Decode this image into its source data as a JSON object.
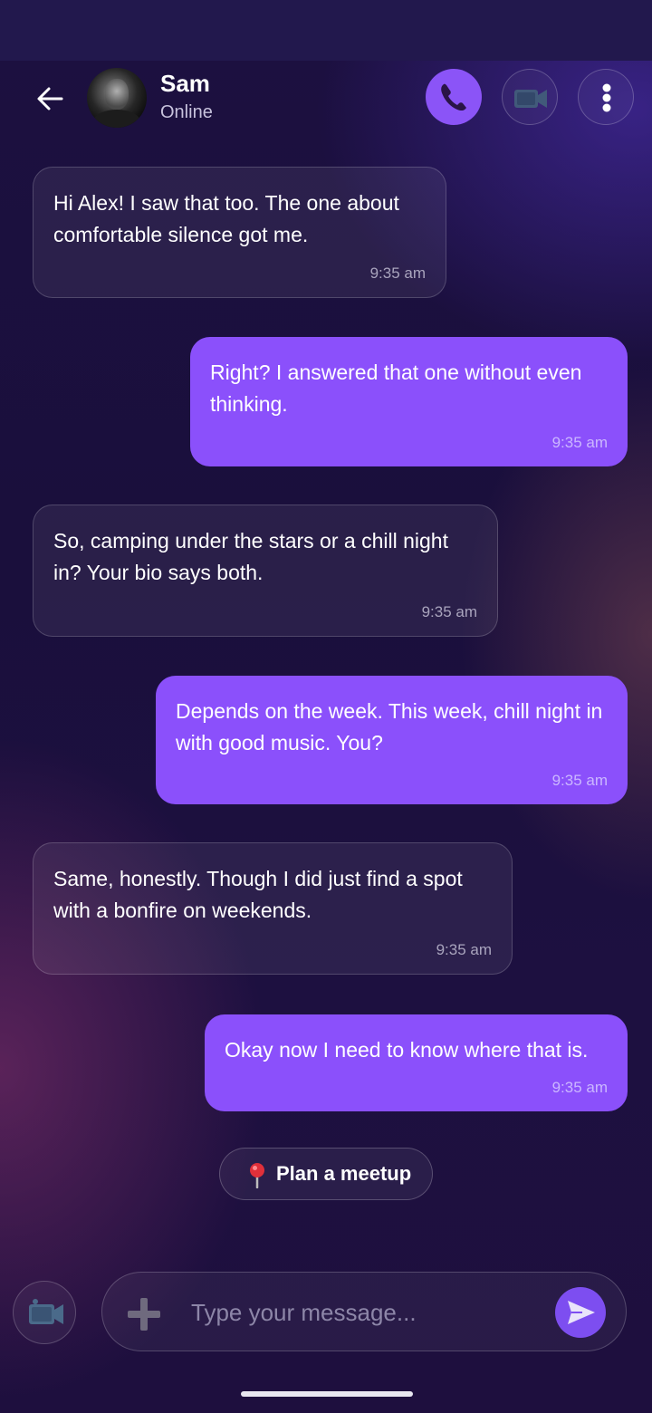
{
  "header": {
    "contact_name": "Sam",
    "contact_status": "Online",
    "icons": [
      "back-arrow-icon",
      "phone-icon",
      "video-camera-icon",
      "more-vertical-icon"
    ]
  },
  "messages": [
    {
      "direction": "incoming",
      "text": "Hi Alex! I saw that too. The one about comfortable silence got me.",
      "time": "9:35 am"
    },
    {
      "direction": "outgoing",
      "text": "Right? I answered that one without even thinking.",
      "time": "9:35 am"
    },
    {
      "direction": "incoming",
      "text": "So, camping under the stars or a chill night in? Your bio says both.",
      "time": "9:35 am"
    },
    {
      "direction": "outgoing",
      "text": "Depends on the week. This week, chill night in with good music. You?",
      "time": "9:35 am"
    },
    {
      "direction": "incoming",
      "text": "Same, honestly. Though I did just find a spot with a bonfire on weekends.",
      "time": "9:35 am"
    },
    {
      "direction": "outgoing",
      "text": "Okay now I need to know where that is.",
      "time": "9:35 am"
    }
  ],
  "meetup_chip": {
    "label": "Plan a meetup",
    "icon": "map-pin-icon"
  },
  "composer": {
    "placeholder": "Type your message...",
    "value": "",
    "icons": [
      "video-camera-icon",
      "plus-icon",
      "send-icon"
    ]
  },
  "colors": {
    "accent": "#8b50fb",
    "background": "#1c1040",
    "incoming_bubble": "rgba(255,255,255,0.07)"
  }
}
